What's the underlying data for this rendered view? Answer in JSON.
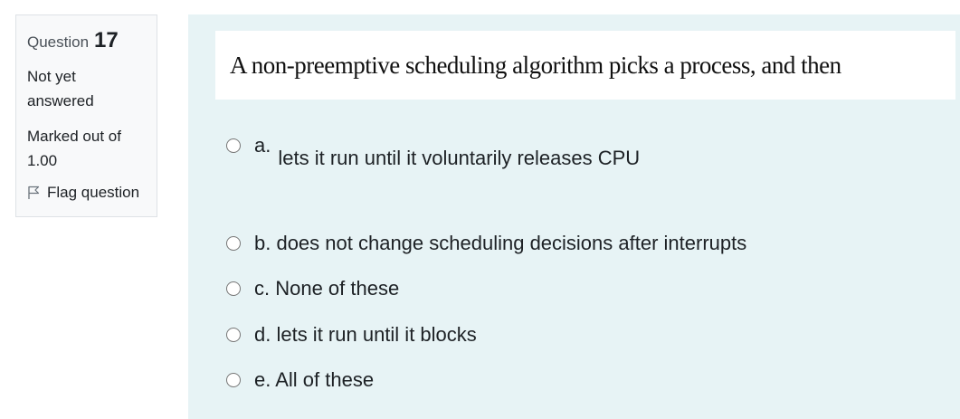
{
  "info": {
    "question_label": "Question",
    "question_number": "17",
    "state_line1": "Not yet",
    "state_line2": "answered",
    "grade_line1": "Marked out of",
    "grade_line2": "1.00",
    "flag_label": "Flag question",
    "flag_icon": "flag-outline-icon"
  },
  "question": {
    "text": "A non-preemptive scheduling algorithm picks a process, and then"
  },
  "answers": [
    {
      "letter": "a.",
      "text": "lets it run until it voluntarily releases CPU"
    },
    {
      "text": "b. does not change scheduling decisions after interrupts"
    },
    {
      "text": "c. None of these"
    },
    {
      "text": "d. lets it run until it blocks"
    },
    {
      "text": "e. All of these"
    }
  ],
  "colors": {
    "content_bg": "#e7f3f5",
    "info_bg": "#f8f9fa",
    "info_border": "#dee2e6"
  }
}
